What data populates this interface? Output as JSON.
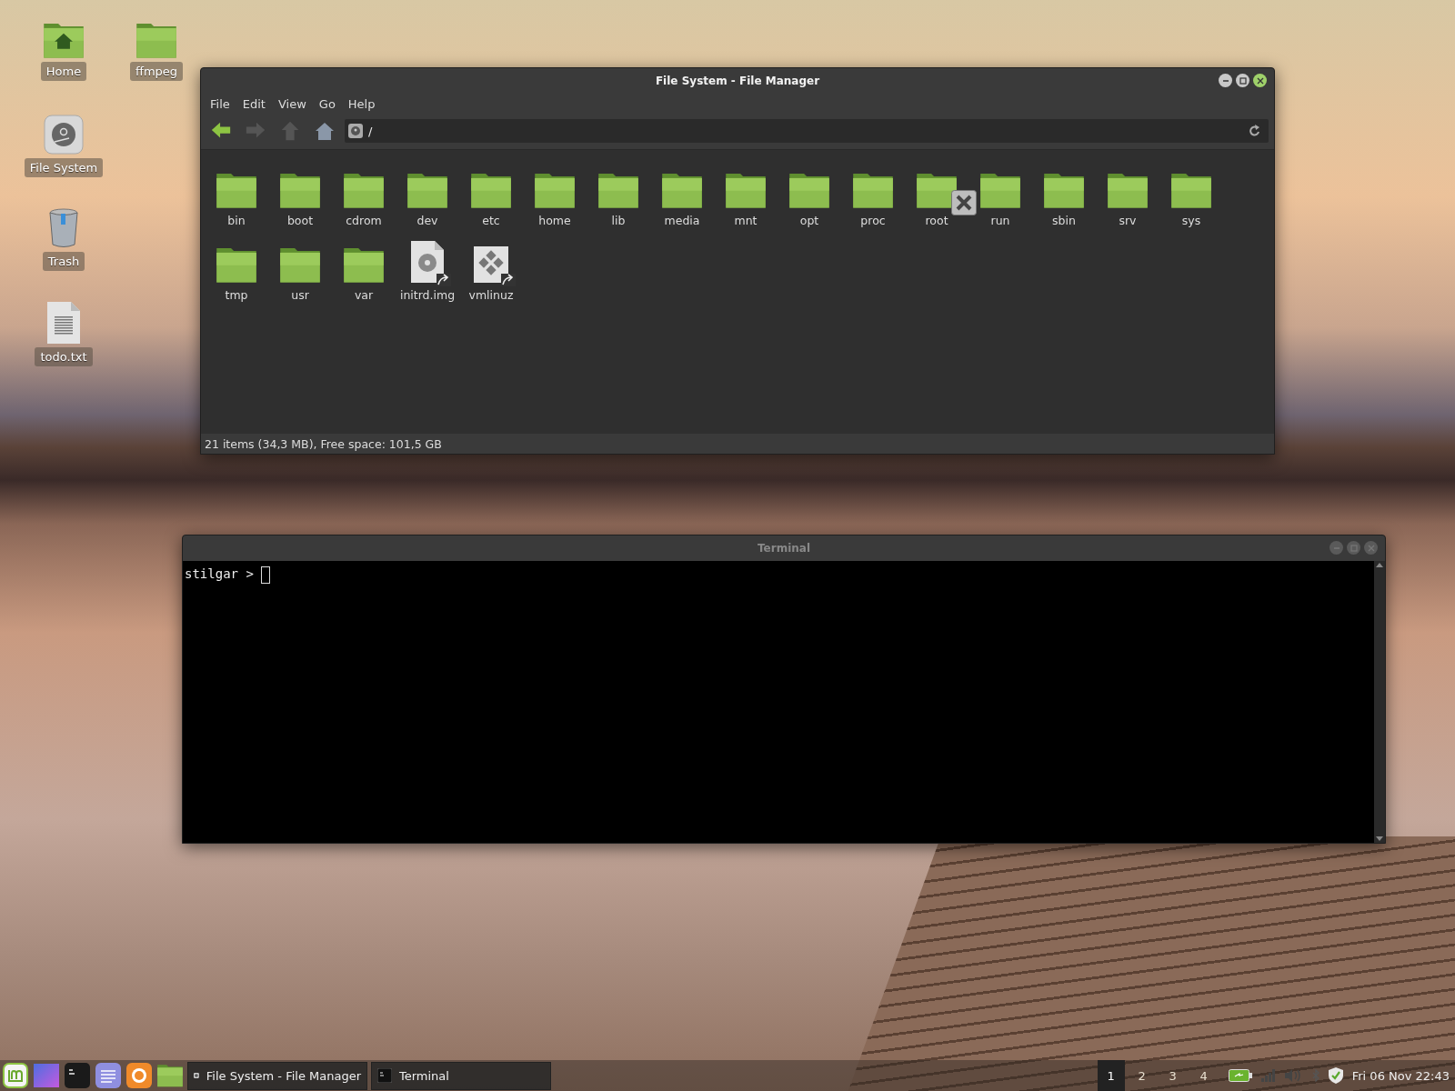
{
  "desktop_icons": [
    {
      "label": "Home",
      "kind": "home-folder"
    },
    {
      "label": "ffmpeg",
      "kind": "folder"
    },
    {
      "label": "File System",
      "kind": "drive"
    },
    {
      "label": "Trash",
      "kind": "trash"
    },
    {
      "label": "todo.txt",
      "kind": "text-file"
    }
  ],
  "file_manager": {
    "title": "File System - File Manager",
    "focused": true,
    "menu": [
      "File",
      "Edit",
      "View",
      "Go",
      "Help"
    ],
    "location": "/",
    "items": [
      {
        "name": "bin",
        "kind": "folder"
      },
      {
        "name": "boot",
        "kind": "folder"
      },
      {
        "name": "cdrom",
        "kind": "folder"
      },
      {
        "name": "dev",
        "kind": "folder"
      },
      {
        "name": "etc",
        "kind": "folder"
      },
      {
        "name": "home",
        "kind": "folder"
      },
      {
        "name": "lib",
        "kind": "folder"
      },
      {
        "name": "media",
        "kind": "folder"
      },
      {
        "name": "mnt",
        "kind": "folder"
      },
      {
        "name": "opt",
        "kind": "folder"
      },
      {
        "name": "proc",
        "kind": "folder"
      },
      {
        "name": "root",
        "kind": "locked-folder"
      },
      {
        "name": "run",
        "kind": "folder"
      },
      {
        "name": "sbin",
        "kind": "folder"
      },
      {
        "name": "srv",
        "kind": "folder"
      },
      {
        "name": "sys",
        "kind": "folder"
      },
      {
        "name": "tmp",
        "kind": "folder"
      },
      {
        "name": "usr",
        "kind": "folder"
      },
      {
        "name": "var",
        "kind": "folder"
      },
      {
        "name": "initrd.img",
        "kind": "disk-link"
      },
      {
        "name": "vmlinuz",
        "kind": "kernel-link"
      }
    ],
    "status_bar": "21 items (34,3 MB), Free space: 101,5 GB"
  },
  "terminal": {
    "title": "Terminal",
    "focused": false,
    "prompt": "stilgar >"
  },
  "taskbar": {
    "windows": [
      {
        "label": "File System - File Manager",
        "kind": "files"
      },
      {
        "label": "Terminal",
        "kind": "terminal"
      }
    ],
    "workspaces": [
      {
        "label": "1",
        "selected": true
      },
      {
        "label": "2",
        "selected": false
      },
      {
        "label": "3",
        "selected": false
      },
      {
        "label": "4",
        "selected": false
      }
    ],
    "clock": "Fri 06 Nov 22:43"
  }
}
